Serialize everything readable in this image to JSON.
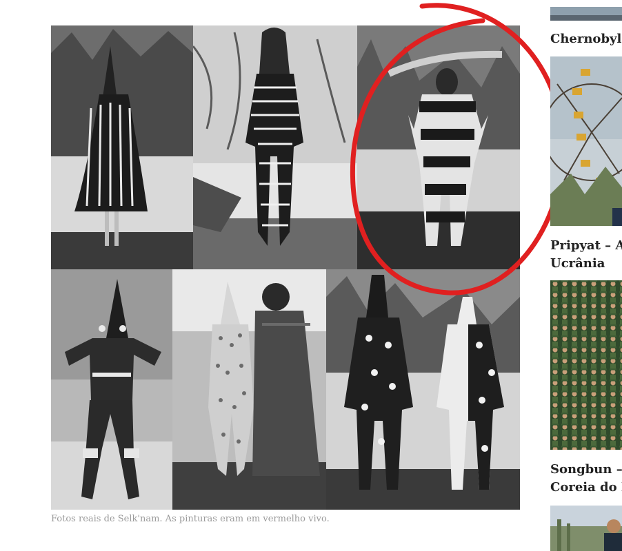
{
  "caption": "Fotos reais de Selk'nam. As pinturas eram em vermelho vivo.",
  "sidebar": {
    "items": [
      {
        "title_lines": [
          "Chernobyl"
        ]
      },
      {
        "title_lines": [
          "Pripyat – A",
          "Ucrânia"
        ]
      },
      {
        "title_lines": [
          "Songbun –",
          "Coreia do N"
        ]
      }
    ]
  },
  "colors": {
    "annotation": "#e02020",
    "caption": "#9a9a9a",
    "title": "#222222"
  }
}
